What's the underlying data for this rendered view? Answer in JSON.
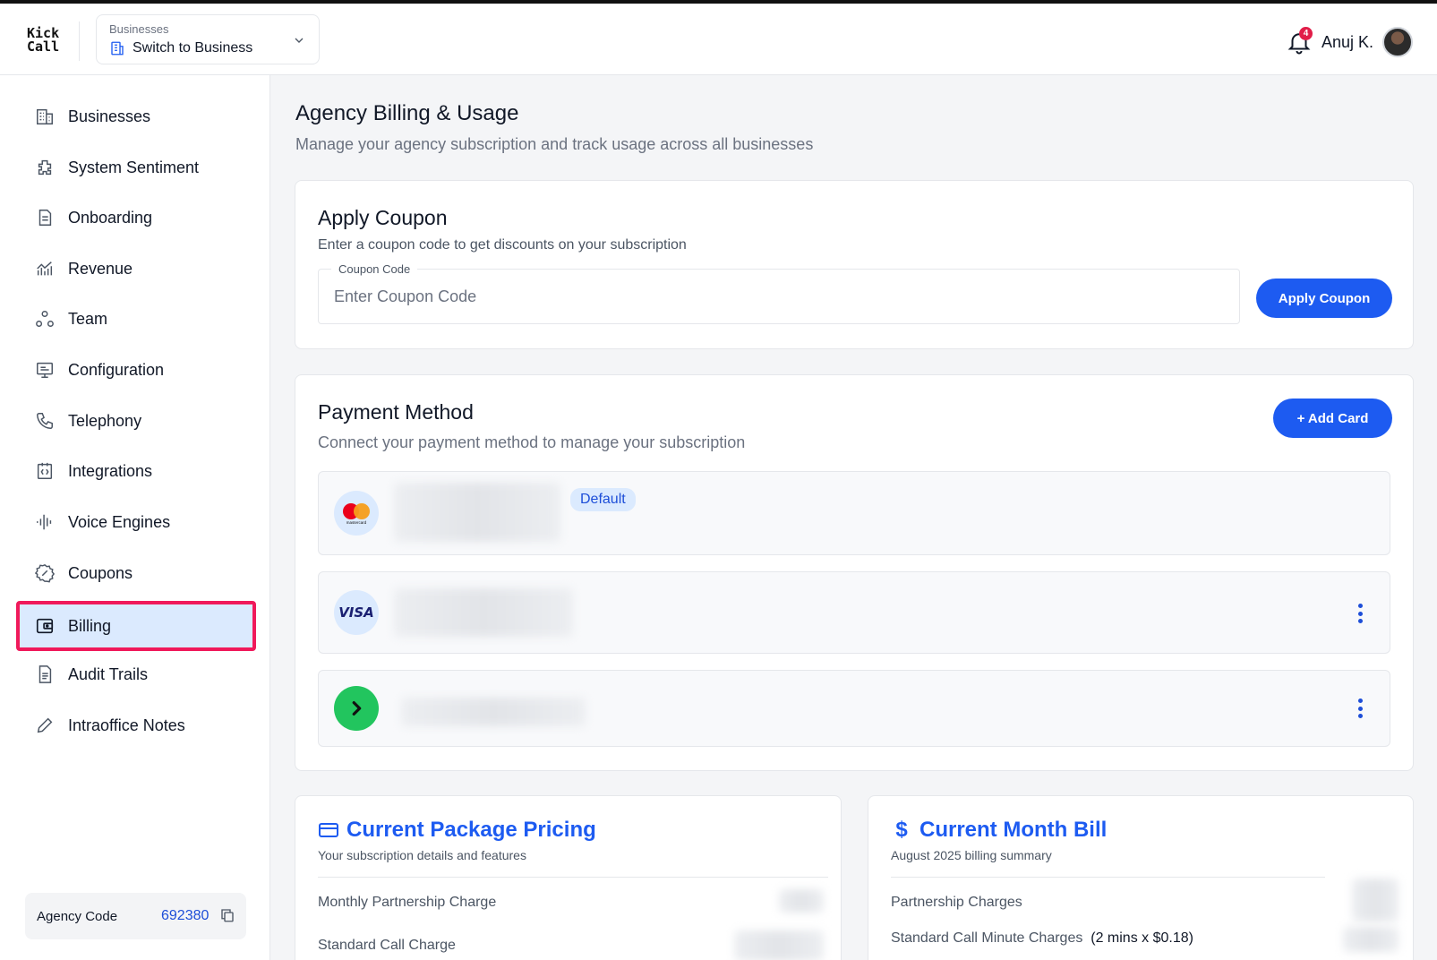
{
  "header": {
    "logo_line1": "Kick",
    "logo_line2": "Call",
    "business_switcher": {
      "label": "Businesses",
      "value": "Switch to Business"
    },
    "notification_count": "4",
    "user_name": "Anuj K."
  },
  "sidebar": {
    "items": [
      {
        "label": "Businesses",
        "icon": "building-icon"
      },
      {
        "label": "System Sentiment",
        "icon": "puzzle-icon"
      },
      {
        "label": "Onboarding",
        "icon": "document-icon"
      },
      {
        "label": "Revenue",
        "icon": "chart-icon"
      },
      {
        "label": "Team",
        "icon": "team-icon"
      },
      {
        "label": "Configuration",
        "icon": "monitor-icon"
      },
      {
        "label": "Telephony",
        "icon": "phone-icon"
      },
      {
        "label": "Integrations",
        "icon": "code-icon"
      },
      {
        "label": "Voice Engines",
        "icon": "waveform-icon"
      },
      {
        "label": "Coupons",
        "icon": "percent-badge-icon"
      },
      {
        "label": "Billing",
        "icon": "wallet-icon",
        "active": true
      },
      {
        "label": "Audit Trails",
        "icon": "file-list-icon"
      },
      {
        "label": "Intraoffice Notes",
        "icon": "pencil-icon"
      }
    ],
    "agency_code_label": "Agency Code",
    "agency_code_value": "692380"
  },
  "main": {
    "title": "Agency Billing & Usage",
    "subtitle": "Manage your agency subscription and track usage across all businesses",
    "coupon": {
      "title": "Apply Coupon",
      "subtitle": "Enter a coupon code to get discounts on your subscription",
      "field_label": "Coupon Code",
      "placeholder": "Enter Coupon Code",
      "value": "",
      "button": "Apply Coupon"
    },
    "payment": {
      "title": "Payment Method",
      "subtitle": "Connect your payment method to manage your subscription",
      "add_button": "+ Add Card",
      "cards": [
        {
          "brand": "mastercard",
          "logo_text": "mastercard",
          "badge": "Default"
        },
        {
          "brand": "visa",
          "logo_text": "VISA"
        },
        {
          "brand": "other",
          "logo_text": ""
        }
      ]
    },
    "package": {
      "title": "Current Package Pricing",
      "subtitle": "Your subscription details and features",
      "rows": [
        "Monthly Partnership Charge",
        "Standard Call Charge"
      ]
    },
    "bill": {
      "title": "Current Month Bill",
      "subtitle": "August 2025 billing summary",
      "rows": [
        "Partnership Charges",
        "Standard Call Minute Charges"
      ],
      "call_minutes_detail": "(2 mins x $0.18)"
    }
  },
  "colors": {
    "accent": "#1d5bf1",
    "active_bg": "#dbeafe",
    "highlight_border": "#f0195b"
  }
}
